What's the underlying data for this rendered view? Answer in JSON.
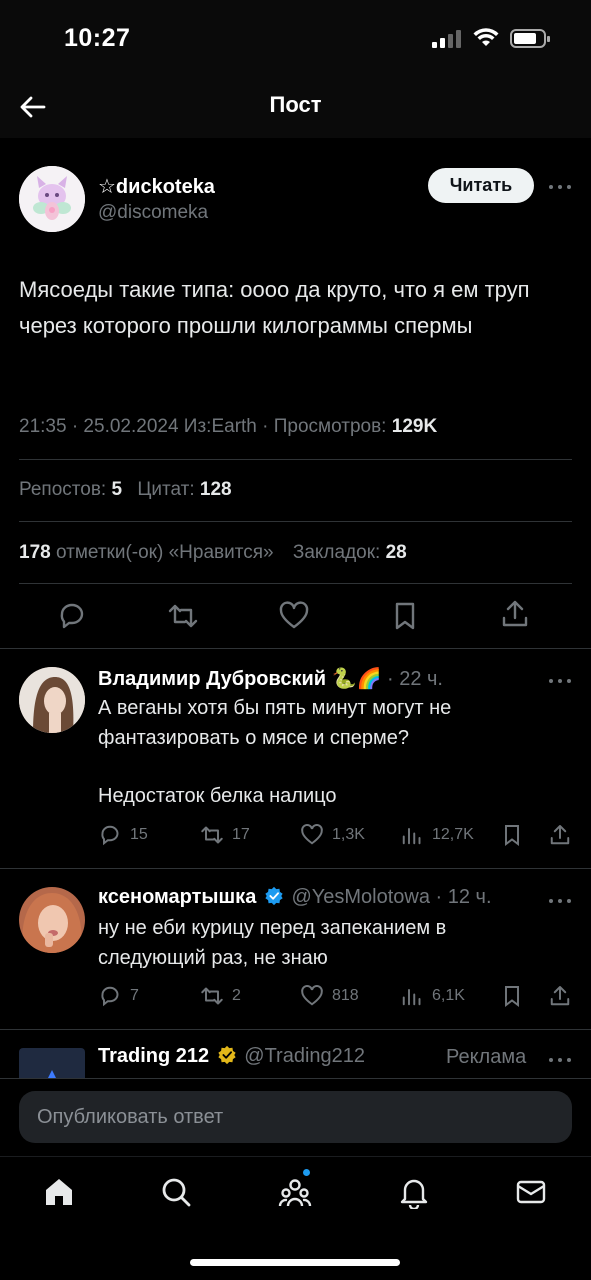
{
  "status_bar": {
    "time": "10:27"
  },
  "nav": {
    "title": "Пост"
  },
  "post": {
    "author_name": "☆dиckoteka",
    "author_handle": "@discomeka",
    "follow_label": "Читать",
    "text": "Мясоеды такие типа: оооо да круто, что я ем труп через которого прошли килограммы спермы",
    "time": "21:35 · 25.02.2024 Из:Earth · Просмотров: ",
    "views": "129K",
    "reposts_label": "Репостов: ",
    "reposts": "5",
    "quotes_label": "Цитат: ",
    "quotes": "128",
    "likes": "178",
    "likes_label": " отметки(-ок) «Нравится»",
    "bookmarks_label": "Закладок: ",
    "bookmarks": "28"
  },
  "replies": [
    {
      "name": "Владимир Дубровский",
      "emoji": "🐍🌈",
      "handle": "",
      "time": " · 22 ч.",
      "text_1": "А веганы хотя бы пять минут могут не фантазировать о мясе и сперме?",
      "text_2": "Недостаток белка налицо",
      "replies": "15",
      "reposts": "17",
      "likes": "1,3K",
      "views": "12,7K"
    },
    {
      "name": "ксеномартышка",
      "handle": "@YesMolotowa",
      "time": " · 12 ч.",
      "text_1": "ну не еби курицу перед запеканием в следующий раз, не знаю",
      "replies": "7",
      "reposts": "2",
      "likes": "818",
      "views": "6,1K"
    }
  ],
  "ad": {
    "name": "Trading 212",
    "handle": "@Trading212",
    "label": "Реклама"
  },
  "composer": {
    "placeholder": "Опубликовать ответ"
  },
  "colors": {
    "accent": "#1d9bf0",
    "muted": "#71767b",
    "gold": "#e2b719"
  }
}
